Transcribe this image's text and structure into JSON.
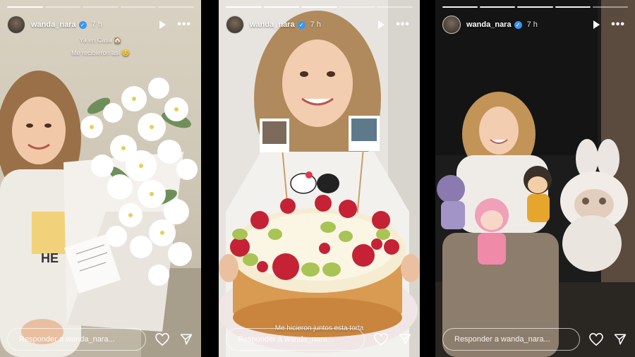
{
  "stories": [
    {
      "username": "wanda_nara",
      "time": "7 h",
      "caption_line1": "Ya en Casa",
      "caption_line2": "Me recibieron así",
      "card_text": "Bienvenida a casa, te quiero mucho",
      "reply_placeholder": "Responder a wanda_nara..."
    },
    {
      "username": "wanda_nara",
      "time": "7 h",
      "caption": "Me hicieron juntos esta torta",
      "reply_placeholder": "Responder a wanda_nara..."
    },
    {
      "username": "wanda_nara",
      "time": "7 h",
      "reply_placeholder": "Responder a wanda_nara..."
    }
  ],
  "icons": {
    "play": "play-icon",
    "more": "more-options-icon",
    "like": "heart-icon",
    "share": "send-icon"
  },
  "colors": {
    "verified_badge": "#3897f0",
    "background": "#000000"
  }
}
